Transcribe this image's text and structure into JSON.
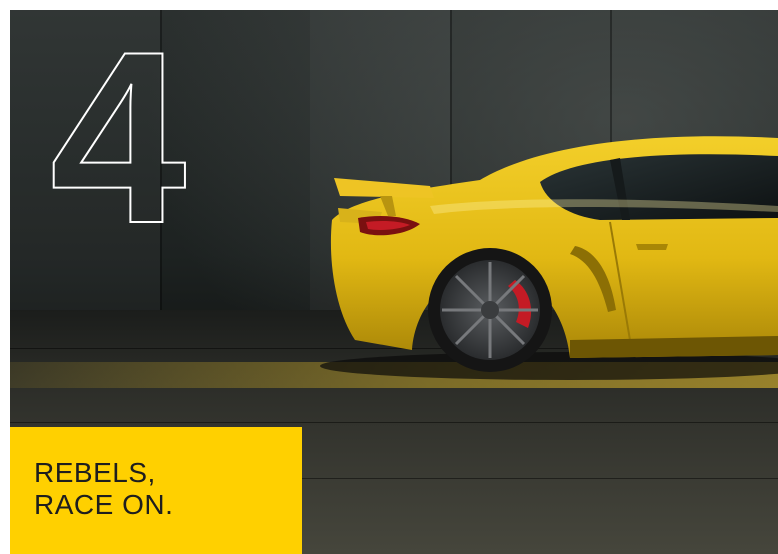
{
  "hero": {
    "numeral": "4",
    "tagline": {
      "line1": "REBELS,",
      "line2": "RACE ON."
    }
  },
  "colors": {
    "accent_yellow": "#ffd000",
    "car_yellow": "#e8bf16",
    "caliper_red": "#c41b25",
    "numeral_outline": "#ffffff",
    "tagline_text": "#1e1e1e"
  }
}
